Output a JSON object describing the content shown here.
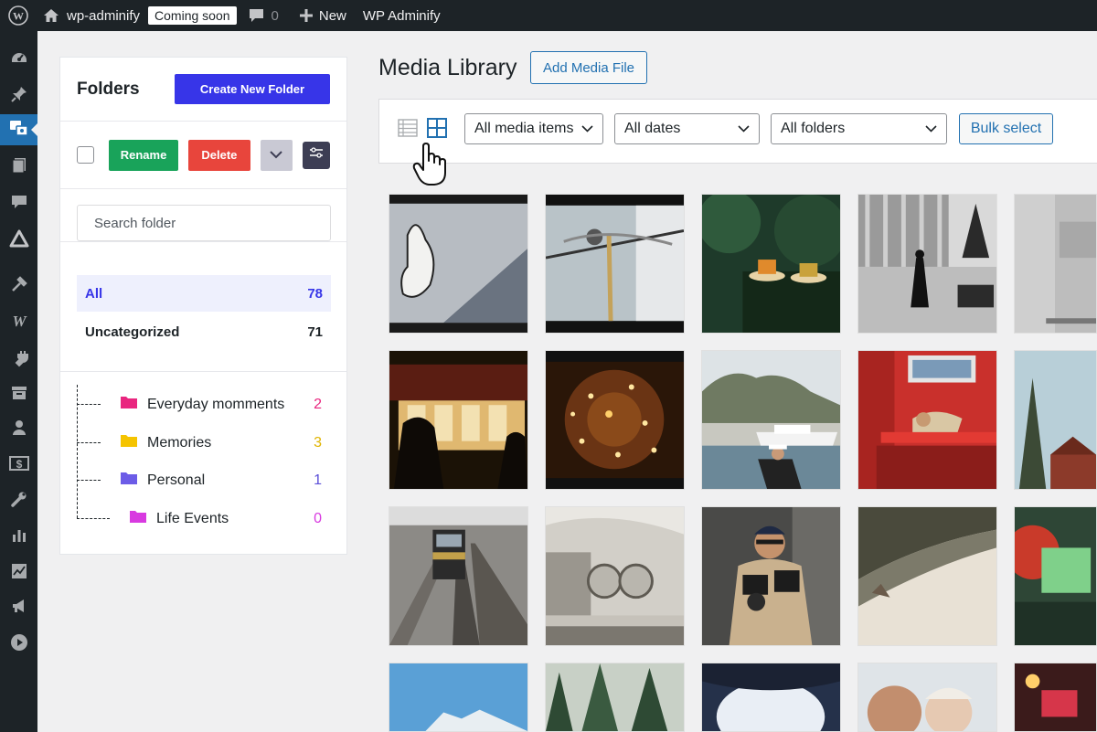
{
  "admin_bar": {
    "site_name": "wp-adminify",
    "status_badge": "Coming soon",
    "comments_count": "0",
    "new_label": "New",
    "plugin_label": "WP Adminify"
  },
  "side_menu": {
    "icons": [
      "dashboard-icon",
      "pin-icon",
      "media-icon",
      "pages-icon",
      "comments-icon",
      "adminify-icon",
      "tools-icon",
      "woo-icon",
      "plugins-icon",
      "archive-icon",
      "users-icon",
      "billing-icon",
      "wrench-icon",
      "stats-icon",
      "analytics-icon",
      "megaphone-icon",
      "play-icon"
    ],
    "active_index": 2,
    "accent_color": "#2271b1"
  },
  "folders": {
    "title": "Folders",
    "create_label": "Create New Folder",
    "rename_label": "Rename",
    "delete_label": "Delete",
    "search_placeholder": "Search folder",
    "categories": [
      {
        "label": "All",
        "count": "78"
      },
      {
        "label": "Uncategorized",
        "count": "71"
      }
    ],
    "tree": [
      {
        "label": "Everyday momments",
        "count": "2",
        "color": "#e9267f"
      },
      {
        "label": "Memories",
        "count": "3",
        "color": "#f5c400"
      },
      {
        "label": "Personal",
        "count": "1",
        "color": "#6c5ce7"
      },
      {
        "label": "Life Events",
        "count": "0",
        "color": "#d83ae0"
      }
    ]
  },
  "main": {
    "title": "Media Library",
    "add_label": "Add Media File",
    "filters": {
      "media_type": "All media items",
      "dates": "All dates",
      "folders": "All folders"
    },
    "bulk_label": "Bulk select"
  }
}
